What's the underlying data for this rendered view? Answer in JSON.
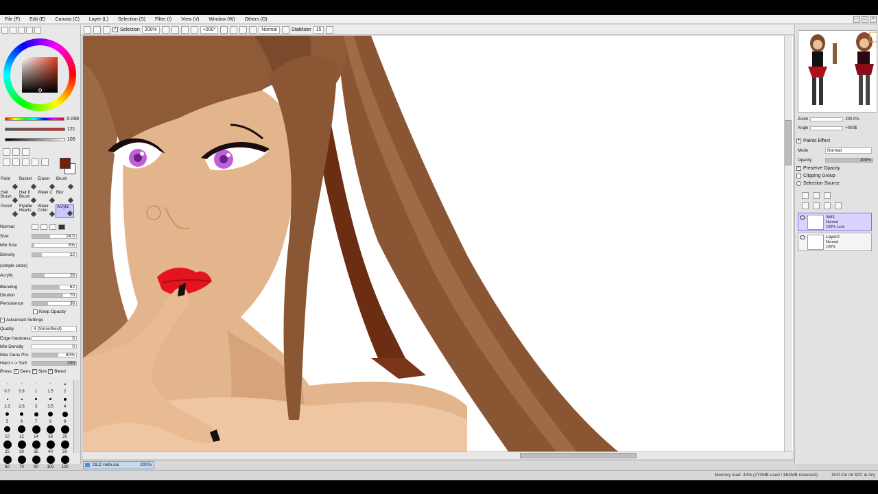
{
  "menu": [
    "File (F)",
    "Edit (E)",
    "Canvas (C)",
    "Layer (L)",
    "Selection (S)",
    "Filter (I)",
    "View (V)",
    "Window (W)",
    "Others (O)"
  ],
  "toolbar": {
    "selection_label": "Selection",
    "zoom": "200%",
    "angle": "+000°",
    "mode": "Normal",
    "stabilizer_label": "Stabilizer",
    "stabilizer_value": "15"
  },
  "color_sliders": [
    {
      "value": "0.068",
      "color": "#d32a2a"
    },
    {
      "value": "121",
      "color": "#8a2c1a"
    },
    {
      "value": "105",
      "color": "#444444"
    }
  ],
  "colors": {
    "foreground": "#7a1e07",
    "background": "#ffffff",
    "selection": "#c9c9ff"
  },
  "tools": [
    {
      "label": "Paint"
    },
    {
      "label": "Bucket"
    },
    {
      "label": "Eraser"
    },
    {
      "label": "Brush"
    },
    {
      "label": "Hair Brush"
    },
    {
      "label": "Hair II Brush"
    },
    {
      "label": "Water 2"
    },
    {
      "label": "Blur"
    },
    {
      "label": "Pencil"
    },
    {
      "label": "Flyable Hearts"
    },
    {
      "label": "Water Color"
    },
    {
      "label": "Acrylic"
    }
  ],
  "brush": {
    "mode": "Normal",
    "size_label": "Size",
    "size_multiplier": "x 1.0",
    "size": "24.0",
    "min_size_label": "Min Size",
    "min_size": "5%",
    "density_label": "Density",
    "density": "22",
    "shape": "(simple circle)",
    "texture": "Acrylic",
    "texture_value": "28",
    "blending_label": "Blending",
    "blending": "62",
    "dilution_label": "Dilution",
    "dilution": "70",
    "persistence_label": "Persistence",
    "persistence": "36",
    "keep_opacity": "Keep Opacity",
    "advanced": "Advanced Settings",
    "quality_label": "Quality",
    "quality": "4 (Smoothest)",
    "edge_hardness_label": "Edge Hardness",
    "edge_hardness": "0",
    "min_density_label": "Min Density",
    "min_density": "0",
    "max_dens_label": "Max Dens Prs.",
    "max_dens": "60%",
    "hard_soft_label": "Hard <-> Soft",
    "hard_soft": "200",
    "press_label": "Press:",
    "press_dens": "Dens",
    "press_size": "Size",
    "press_blend": "Blend"
  },
  "brush_sizes": [
    "0.7",
    "0.8",
    "1",
    "1.5",
    "2",
    "2.3",
    "2.6",
    "3",
    "3.5",
    "4",
    "5",
    "6",
    "7",
    "8",
    "9",
    "10",
    "12",
    "14",
    "16",
    "20",
    "25",
    "30",
    "35",
    "40",
    "50",
    "60",
    "70",
    "80",
    "100",
    "120"
  ],
  "document_tab": {
    "name": "OLD redo.sai",
    "zoom": "200%"
  },
  "navigator": {
    "zoom_label": "Zoom",
    "zoom": "200.0%",
    "angle_label": "Angle",
    "angle": "+000$"
  },
  "layer_panel": {
    "paint_effect": "Paints Effect",
    "mode_label": "Mode",
    "mode": "Normal",
    "opacity_label": "Opacity",
    "opacity": "100%",
    "preserve_opacity": "Preserve Opacity",
    "clipping_group": "Clipping Group",
    "selection_source": "Selection Source"
  },
  "layers": [
    {
      "name": "Set1",
      "mode": "Normal",
      "opacity": "100% Lock"
    },
    {
      "name": "Layer2",
      "mode": "Normal",
      "opacity": "100%"
    }
  ],
  "status": {
    "memory": "Memory load: 43% (270MB used / 884MB reserved)",
    "keys": "Shift Ctrl Alt SPC ⊕ Any"
  }
}
